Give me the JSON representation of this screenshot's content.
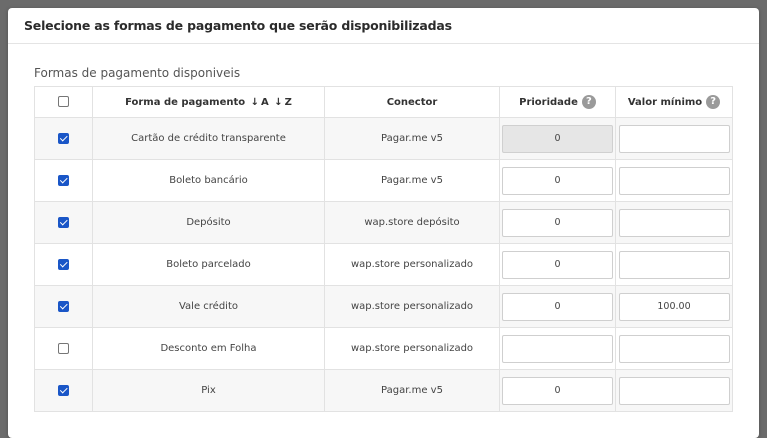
{
  "modal": {
    "title": "Selecione as formas de pagamento que serão disponibilizadas",
    "section_label": "Formas de pagamento disponiveis"
  },
  "table": {
    "headers": {
      "method": "Forma de pagamento",
      "sort_a": "A",
      "sort_z": "Z",
      "connector": "Conector",
      "priority": "Prioridade",
      "min_value": "Valor mínimo"
    },
    "select_all_checked": false,
    "rows": [
      {
        "checked": true,
        "method": "Cartão de crédito transparente",
        "connector": "Pagar.me v5",
        "priority": "0",
        "min_value": "",
        "priority_disabled": true
      },
      {
        "checked": true,
        "method": "Boleto bancário",
        "connector": "Pagar.me v5",
        "priority": "0",
        "min_value": "",
        "priority_disabled": false
      },
      {
        "checked": true,
        "method": "Depósito",
        "connector": "wap.store depósito",
        "priority": "0",
        "min_value": "",
        "priority_disabled": false
      },
      {
        "checked": true,
        "method": "Boleto parcelado",
        "connector": "wap.store personalizado",
        "priority": "0",
        "min_value": "",
        "priority_disabled": false
      },
      {
        "checked": true,
        "method": "Vale crédito",
        "connector": "wap.store personalizado",
        "priority": "0",
        "min_value": "100.00",
        "priority_disabled": false
      },
      {
        "checked": false,
        "method": "Desconto em Folha",
        "connector": "wap.store personalizado",
        "priority": "",
        "min_value": "",
        "priority_disabled": false
      },
      {
        "checked": true,
        "method": "Pix",
        "connector": "Pagar.me v5",
        "priority": "0",
        "min_value": "",
        "priority_disabled": false
      }
    ]
  },
  "icons": {
    "help": "question-circle-icon",
    "sort_down": "arrow-down-icon"
  },
  "colors": {
    "checkbox_checked": "#1a56c7",
    "disabled_input": "#e6e6e6"
  }
}
